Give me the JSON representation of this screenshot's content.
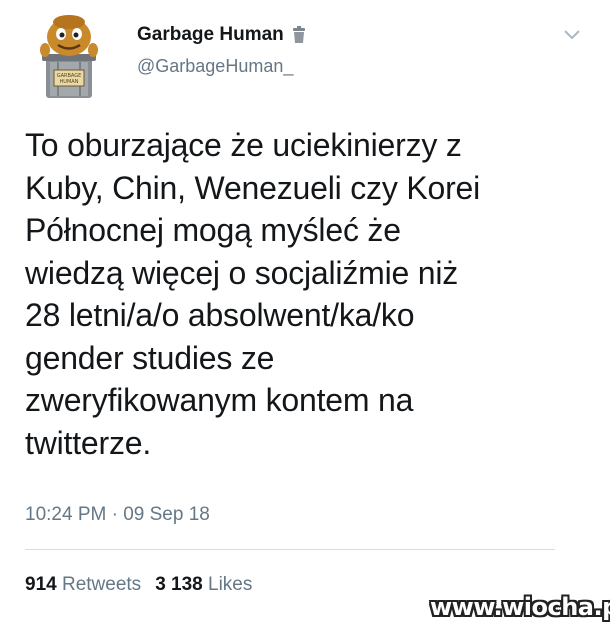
{
  "user": {
    "display_name": "Garbage Human",
    "handle": "@GarbageHuman_",
    "avatar_label": "GARBAGE HUMAN"
  },
  "tweet": {
    "lines": [
      "To oburzające że uciekinierzy z",
      "Kuby, Chin, Wenezueli czy Korei",
      "Północnej mogą myśleć że",
      "wiedzą więcej o socjaliźmie niż",
      "28 letni/a/o absolwent/ka/ko",
      "gender studies ze",
      "zweryfikowanym kontem na",
      "twitterze."
    ],
    "timestamp": "10:24 PM · 09 Sep 18"
  },
  "stats": {
    "retweets_count": "914",
    "retweets_label": "Retweets",
    "likes_count": "3 138",
    "likes_label": "Likes"
  },
  "watermark": "www.wiocha.pl",
  "icons": {
    "caret": "chevron-down-icon",
    "badge": "trash-can-icon"
  },
  "colors": {
    "text": "#14171a",
    "secondary": "#657786",
    "divider": "#d7dde2"
  }
}
